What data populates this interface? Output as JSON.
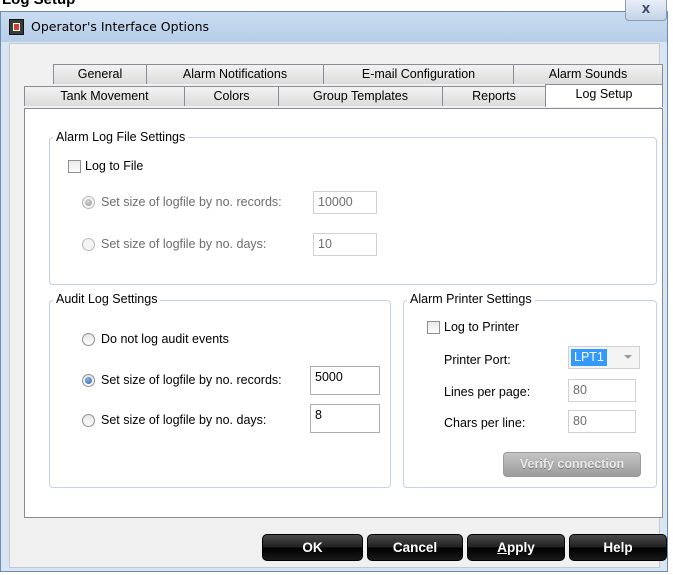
{
  "window": {
    "title": "Operator's Interface Options",
    "close_glyph": "X",
    "clipped_heading": "Log Setup"
  },
  "tabs": {
    "row_back": [
      "General",
      "Alarm Notifications",
      "E-mail Configuration",
      "Alarm Sounds"
    ],
    "row_front": [
      "Tank Movement",
      "Colors",
      "Group Templates",
      "Reports",
      "Log Setup"
    ],
    "active": "Log Setup"
  },
  "alarm_log": {
    "title": "Alarm Log File Settings",
    "log_to_file_label": "Log to File",
    "log_to_file_checked": false,
    "by_records_label": "Set size of logfile by no. records:",
    "by_records_value": "10000",
    "by_days_label": "Set size of logfile by no. days:",
    "by_days_value": "10",
    "selected": "by_records",
    "enabled": false
  },
  "audit_log": {
    "title": "Audit Log Settings",
    "do_not_log_label": "Do not log audit events",
    "by_records_label": "Set size of logfile by no. records:",
    "by_records_value": "5000",
    "by_days_label": "Set size of logfile by no. days:",
    "by_days_value": "8",
    "selected": "by_records"
  },
  "printer": {
    "title": "Alarm Printer Settings",
    "log_to_printer_label": "Log to Printer",
    "log_to_printer_checked": false,
    "port_label": "Printer Port:",
    "port_value": "LPT1",
    "lines_label": "Lines per page:",
    "lines_value": "80",
    "chars_label": "Chars per line:",
    "chars_value": "80",
    "verify_label": "Verify connection"
  },
  "buttons": {
    "ok": "OK",
    "cancel": "Cancel",
    "apply": "Apply",
    "apply_mnemonic": "A",
    "apply_rest": "pply",
    "help": "Help"
  },
  "colors": {
    "accent": "#3399ff",
    "window_frame": "#dbe5f1",
    "button_dark": "#1f1f1f"
  }
}
